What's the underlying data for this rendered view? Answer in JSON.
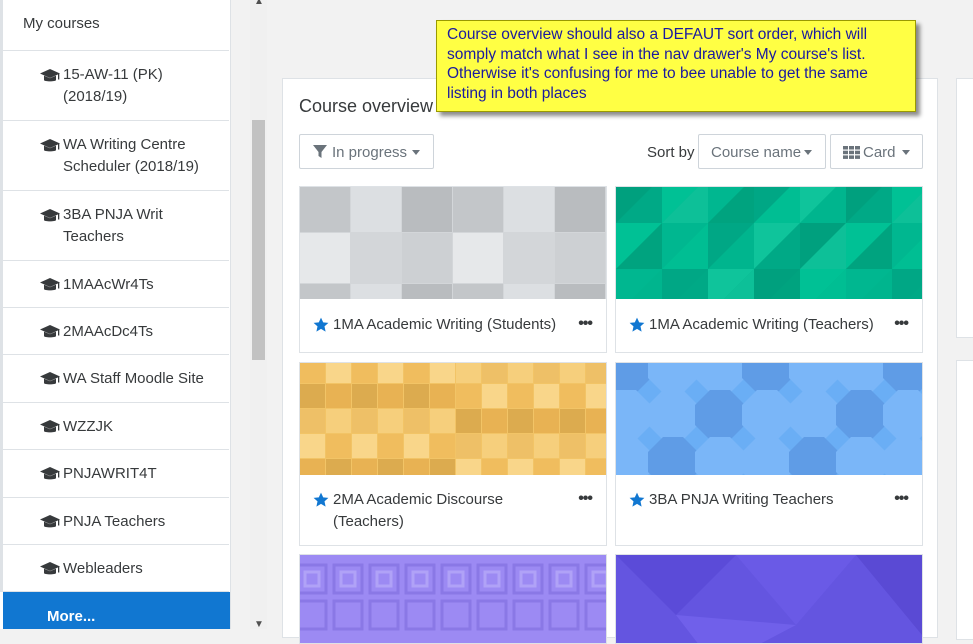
{
  "drawer": {
    "heading": "My courses",
    "courses": [
      {
        "label": "15-AW-11 (PK) (2018/19)"
      },
      {
        "label": "WA Writing Centre Scheduler (2018/19)"
      },
      {
        "label": "3BA PNJA Writ Teachers"
      },
      {
        "label": "1MAAcWr4Ts"
      },
      {
        "label": "2MAAcDc4Ts"
      },
      {
        "label": "WA Staff Moodle Site"
      },
      {
        "label": "WZZJK"
      },
      {
        "label": "PNJAWRIT4T"
      },
      {
        "label": "PNJA Teachers"
      },
      {
        "label": "Webleaders"
      }
    ],
    "more_label": "More...",
    "icon": "graduation-cap-icon"
  },
  "overview": {
    "title": "Course overview",
    "filter_label": "In progress",
    "sort_by_label": "Sort by",
    "sort_value": "Course name",
    "view_value": "Card"
  },
  "courses": [
    {
      "name": "1MA Academic Writing (Students)",
      "starred": true,
      "color": "#d3d6d9"
    },
    {
      "name": "1MA Academic Writing (Teachers)",
      "starred": true,
      "color": "#00b08a"
    },
    {
      "name": "2MA Academic Discourse (Teachers)",
      "starred": true,
      "color": "#f2c466"
    },
    {
      "name": "3BA PNJA Writing Teachers",
      "starred": true,
      "color": "#6aaef5"
    },
    {
      "name": "",
      "starred": false,
      "color": "#9c8af3"
    },
    {
      "name": "",
      "starred": false,
      "color": "#6455e0"
    }
  ],
  "note": {
    "text": "Course overview should also a DEFAUT sort order, which will somply match what I see in the nav drawer's My course's list. Otherwise it's confusing for me to bee unable to get the same listing in both places"
  },
  "colors": {
    "accent": "#1177d1",
    "note_bg": "#ffff44",
    "note_text": "#1a1aa0"
  }
}
